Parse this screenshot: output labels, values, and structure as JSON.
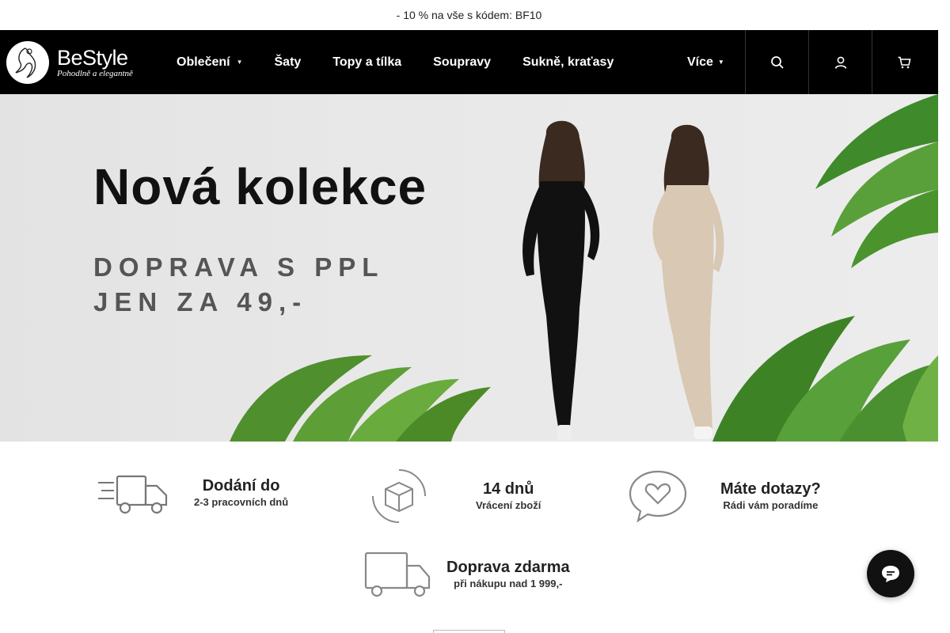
{
  "announcement": "- 10 % na vše s kódem: BF10",
  "logo": {
    "name": "BeStyle",
    "tagline": "Pohodlně a elegantně"
  },
  "nav": {
    "items": [
      {
        "label": "Oblečení",
        "dropdown": true
      },
      {
        "label": "Šaty",
        "dropdown": false
      },
      {
        "label": "Topy a tílka",
        "dropdown": false
      },
      {
        "label": "Soupravy",
        "dropdown": false
      },
      {
        "label": "Sukně, kraťasy",
        "dropdown": false
      }
    ],
    "more_label": "Více"
  },
  "header_icons": [
    "search-icon",
    "user-icon",
    "cart-icon"
  ],
  "hero": {
    "title": "Nová kolekce",
    "line1": "DOPRAVA S PPL",
    "line2": "JEN ZA 49,-"
  },
  "features": [
    {
      "title": "Dodání do",
      "subtitle": "2-3 pracovních dnů",
      "icon": "delivery-truck-icon"
    },
    {
      "title": "14 dnů",
      "subtitle": "Vrácení zboží",
      "icon": "return-box-icon"
    },
    {
      "title": "Máte dotazy?",
      "subtitle": "Rádi vám poradíme",
      "icon": "heart-chat-icon"
    },
    {
      "title": "Doprava zdarma",
      "subtitle": "při nákupu nad 1  999,-",
      "icon": "free-shipping-truck-icon"
    }
  ],
  "chat_icon": "chat-bubble-icon",
  "colors": {
    "header_bg": "#000000",
    "hero_bg": "#e6e6e6",
    "leaf_green": "#3d8a2a",
    "chat_bg": "#111111"
  }
}
